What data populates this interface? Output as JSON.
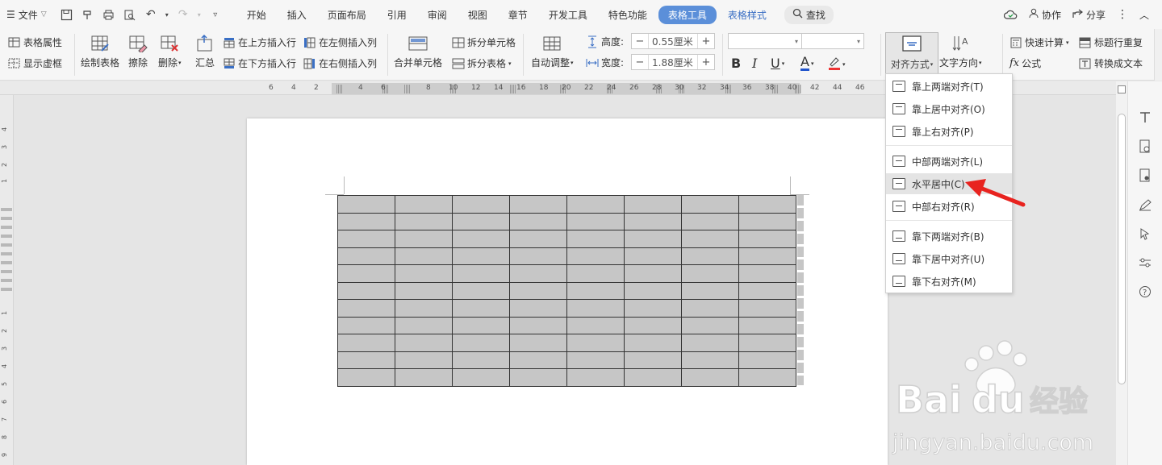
{
  "menubar": {
    "file_label": "文件",
    "tabs": [
      "开始",
      "插入",
      "页面布局",
      "引用",
      "审阅",
      "视图",
      "章节",
      "开发工具",
      "特色功能"
    ],
    "active_tab": "表格工具",
    "secondary_tab": "表格样式",
    "search_label": "查找",
    "collab_label": "协作",
    "share_label": "分享"
  },
  "ribbon": {
    "table_props": "表格属性",
    "show_gridlines": "显示虚框",
    "draw_table": "绘制表格",
    "erase": "擦除",
    "delete": "删除",
    "summary": "汇总",
    "insert_above": "在上方插入行",
    "insert_below": "在下方插入行",
    "insert_left": "在左侧插入列",
    "insert_right": "在右侧插入列",
    "merge_cells": "合并单元格",
    "split_cells": "拆分单元格",
    "split_table": "拆分表格",
    "auto_fit": "自动调整",
    "height_label": "高度:",
    "height_value": "0.55厘米",
    "width_label": "宽度:",
    "width_value": "1.88厘米",
    "bold": "B",
    "italic": "I",
    "underline": "U",
    "font_color": "A",
    "align": "对齐方式",
    "text_direction": "文字方向",
    "quick_calc": "快速计算",
    "formula": "公式",
    "repeat_header": "标题行重复",
    "to_text": "转换成文本"
  },
  "ruler": {
    "h_numbers": [
      "6",
      "4",
      "2",
      "2",
      "4",
      "6",
      "8",
      "10",
      "12",
      "14",
      "16",
      "18",
      "20",
      "22",
      "24",
      "26",
      "28",
      "30",
      "32",
      "34",
      "36",
      "38",
      "40",
      "42",
      "44",
      "46"
    ],
    "v_numbers": [
      "4",
      "3",
      "2",
      "1",
      "1",
      "2",
      "3",
      "4",
      "5",
      "6",
      "7",
      "8",
      "9",
      "10",
      "11",
      "12",
      "13",
      "14",
      "15",
      "16"
    ]
  },
  "dropdown": {
    "items": [
      {
        "label": "靠上两端对齐(T)"
      },
      {
        "label": "靠上居中对齐(O)"
      },
      {
        "label": "靠上右对齐(P)"
      },
      {
        "label": "中部两端对齐(L)"
      },
      {
        "label": "水平居中(C)"
      },
      {
        "label": "中部右对齐(R)"
      },
      {
        "label": "靠下两端对齐(B)"
      },
      {
        "label": "靠下居中对齐(U)"
      },
      {
        "label": "靠下右对齐(M)"
      }
    ],
    "highlighted_index": 4
  },
  "table": {
    "rows": 11,
    "cols": 8
  },
  "watermark": {
    "brand": "Bai",
    "brand2": "du",
    "cn": "经验",
    "url": "jingyan.baidu.com"
  },
  "colors": {
    "accent": "#5b8fd9",
    "cell_fill": "#c6c6c6",
    "arrow": "#e8231f"
  }
}
